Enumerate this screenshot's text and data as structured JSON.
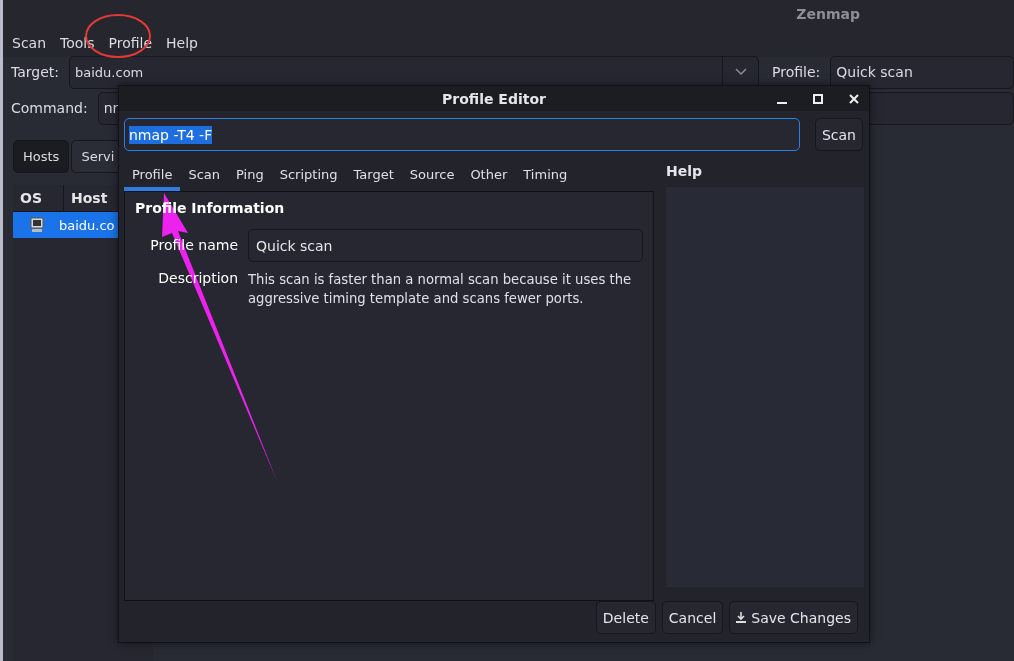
{
  "window": {
    "title": "Zenmap"
  },
  "menu": [
    "Scan",
    "Tools",
    "Profile",
    "Help"
  ],
  "target": {
    "label": "Target:",
    "value": "baidu.com"
  },
  "profile": {
    "label": "Profile:",
    "value": "Quick scan"
  },
  "command": {
    "label": "Command:",
    "value": "nr"
  },
  "tabs": [
    {
      "label": "Hosts",
      "selected": true
    },
    {
      "label": "Servi",
      "selected": false
    }
  ],
  "hosts_table": {
    "columns": [
      "OS",
      "Host"
    ],
    "rows": [
      {
        "host": "baidu.co",
        "selected": true
      }
    ]
  },
  "dialog": {
    "title": "Profile Editor",
    "command": "nmap -T4 -F",
    "scan_button": "Scan",
    "tabs": [
      {
        "label": "Profile",
        "selected": true
      },
      {
        "label": "Scan",
        "selected": false
      },
      {
        "label": "Ping",
        "selected": false
      },
      {
        "label": "Scripting",
        "selected": false
      },
      {
        "label": "Target",
        "selected": false
      },
      {
        "label": "Source",
        "selected": false
      },
      {
        "label": "Other",
        "selected": false
      },
      {
        "label": "Timing",
        "selected": false
      }
    ],
    "section_title": "Profile Information",
    "fields": [
      {
        "label": "Profile name",
        "kind": "input",
        "value": "Quick scan"
      },
      {
        "label": "Description",
        "kind": "text",
        "value": "This scan is faster than a normal scan because it uses the aggressive timing template and scans fewer ports."
      }
    ],
    "help_title": "Help",
    "buttons": [
      {
        "label": "Delete",
        "kind": "plain"
      },
      {
        "label": "Cancel",
        "kind": "plain"
      },
      {
        "label": "Save Changes",
        "kind": "save"
      }
    ]
  }
}
